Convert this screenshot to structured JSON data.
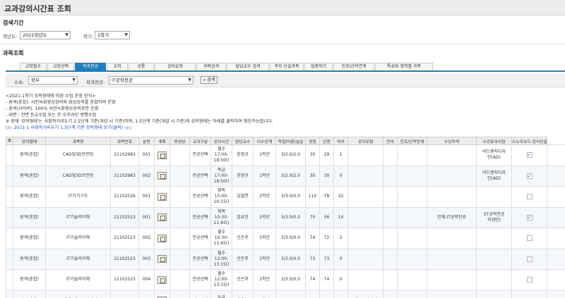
{
  "page": {
    "title": "교과강의시간표 조회"
  },
  "search": {
    "heading": "검색기간",
    "year_label": "학년도:",
    "year_value": "2021학년도",
    "term_label": "학기:",
    "term_value": "1학기"
  },
  "course": {
    "heading": "과목조회",
    "tabs": [
      {
        "label": "교양필수",
        "active": false
      },
      {
        "label": "교양선택",
        "active": false
      },
      {
        "label": "학과전공",
        "active": true
      },
      {
        "label": "교직",
        "active": false
      },
      {
        "label": "공통",
        "active": false
      },
      {
        "label": "강의유형",
        "active": false
      },
      {
        "label": "과목검색",
        "active": false
      },
      {
        "label": "담당교수 검색",
        "active": false
      },
      {
        "label": "학부 신설과목",
        "active": false
      },
      {
        "label": "집중학기",
        "active": false
      },
      {
        "label": "진로/산학연계",
        "active": false
      },
      {
        "label": "특성화 영역별 과목",
        "active": false
      }
    ],
    "affil_label": "소속:",
    "affil_value": "학부",
    "major_label": "학과전공:",
    "major_value": "IT공학전공",
    "search_button": "검색"
  },
  "notes": [
    "<2021-1학기 강의형태에 따른 수업 운영 방식>",
    "- 원격(혼합): 사전녹화영상강의와 화상강의를 혼합하여 운영",
    "- 원격(사이버): 100% 사전녹화영상강의로만 운영",
    "- 대면 : 전면 등교수업 또는 온·오프라인 병행수업",
    "※ 현재 '강의형태'는 사회적거리두기 2.5단계 기준(개강 시 기준)이며, 1.5단계 기준(개설 시 기준)의 강의형태는 아래를 클릭하여 확인가능합니다."
  ],
  "link_text": "▷▷ 2021-1 사회적거리두기 1.5단계 기준 강의형태 보기(클릭) ◁◁",
  "table": {
    "columns": [
      "강의형태",
      "과목명",
      "과목번호",
      "분반",
      "계획",
      "동영상",
      "교과구분",
      "강의시간",
      "담당교수",
      "이수단계",
      "학점/이론/실습",
      "정원",
      "신청",
      "여석",
      "강의유형",
      "언어",
      "진로/산학연계",
      "수강자격",
      "수강유의사항",
      "스노우보드-온라인출석부"
    ],
    "rows": [
      {
        "type": "원격(혼합)",
        "name": "CAD및3D프린팅",
        "code": "21102983",
        "section": "001",
        "category": "전공선택",
        "time": "월수\n17:00-\n18:50()",
        "prof": "윤정규",
        "stage": "1학년",
        "credit": "3/2.0/2.0",
        "cap": "30",
        "applied": "29",
        "remain": "1",
        "ltype": "",
        "lang": "",
        "career": "",
        "qual": "",
        "caution": "어드벤처디자\n인(AD)",
        "snow": true
      },
      {
        "type": "원격(혼합)",
        "name": "CAD및3D프린팅",
        "code": "21102983",
        "section": "002",
        "category": "전공선택",
        "time": "목금\n17:00-\n18:50()",
        "prof": "윤정규",
        "stage": "1학년",
        "credit": "3/2.0/2.0",
        "cap": "30",
        "applied": "30",
        "remain": "0",
        "ltype": "",
        "lang": "",
        "career": "",
        "qual": "",
        "caution": "어드벤처디자\n인(AD)",
        "snow": true
      },
      {
        "type": "원격(혼합)",
        "name": "IT기기구조",
        "code": "21102526",
        "section": "001",
        "category": "전공선택",
        "time": "화목\n15:00-\n16:15()",
        "prof": "김철연",
        "stage": "2학년",
        "credit": "3/3.0/0.0",
        "cap": "110",
        "applied": "78",
        "remain": "32",
        "ltype": "",
        "lang": "",
        "career": "",
        "qual": "",
        "caution": "",
        "snow": false
      },
      {
        "type": "원격(혼합)",
        "name": "IT기술의이해",
        "code": "21102523",
        "section": "001",
        "category": "전공선택",
        "time": "화목\n10:30-\n11:45()",
        "prof": "임유진",
        "stage": "1학년",
        "credit": "3/3.0/0.0",
        "cap": "70",
        "applied": "56",
        "remain": "14",
        "ltype": "",
        "lang": "",
        "career": "",
        "qual": "전체-IT공학전공",
        "caution": "(IT공학전공\n학생만)",
        "snow": true
      },
      {
        "type": "원격(혼합)",
        "name": "IT기술의이해",
        "code": "21102523",
        "section": "002",
        "category": "전공선택",
        "time": "월수\n10:30-\n11:45()",
        "prof": "신은주",
        "stage": "1학년",
        "credit": "3/3.0/0.0",
        "cap": "74",
        "applied": "72",
        "remain": "2",
        "ltype": "",
        "lang": "",
        "career": "",
        "qual": "",
        "caution": "",
        "snow": false
      },
      {
        "type": "원격(혼합)",
        "name": "IT기술의이해",
        "code": "21102523",
        "section": "003",
        "category": "전공선택",
        "time": "월수\n12:00-\n13:15()",
        "prof": "신은주",
        "stage": "1학년",
        "credit": "3/3.0/0.0",
        "cap": "73",
        "applied": "73",
        "remain": "0",
        "ltype": "",
        "lang": "",
        "career": "",
        "qual": "",
        "caution": "",
        "snow": false
      },
      {
        "type": "원격(혼합)",
        "name": "IT기술의이해",
        "code": "21102523",
        "section": "004",
        "category": "전공선택",
        "time": "월수\n12:00-\n13:15()",
        "prof": "신은주",
        "stage": "1학년",
        "credit": "3/3.0/0.0",
        "cap": "74",
        "applied": "74",
        "remain": "0",
        "ltype": "",
        "lang": "",
        "career": "",
        "qual": "",
        "caution": "",
        "snow": false
      },
      {
        "type": "원격(혼합)",
        "name": "IoT응용(캡스톤디자인)",
        "code": "21102535",
        "section": "001",
        "category": "전공선택",
        "time": "수금\n16:30-",
        "prof": "윤용익",
        "stage": "4학년",
        "credit": "3/3.0/0.0",
        "cap": "65",
        "applied": "9",
        "remain": "56",
        "ltype": "캡스톤디자인",
        "lang": "",
        "career": "",
        "qual": "",
        "caution": "",
        "snow": false
      }
    ]
  }
}
